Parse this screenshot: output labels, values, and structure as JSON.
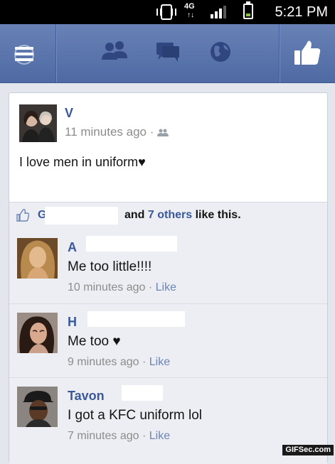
{
  "status_bar": {
    "time": "5:21 PM",
    "network": "4G",
    "network_arrows": "↑↓",
    "icons": [
      "vibrate-icon",
      "signal-icon",
      "battery-icon"
    ]
  },
  "nav": {
    "icons": [
      "menu-icon",
      "friend-requests-icon",
      "messages-icon",
      "notifications-globe-icon",
      "like-thumb-icon"
    ]
  },
  "post": {
    "author": "V",
    "time": "11 minutes ago",
    "separator": "·",
    "audience_icon": "friends-icon",
    "text": "I love men in uniform♥"
  },
  "likes": {
    "first_name": "G",
    "and": "and",
    "others": "7 others",
    "suffix": "like this."
  },
  "comments": [
    {
      "name": "A",
      "text": "Me too little!!!!",
      "time": "10 minutes ago",
      "separator": "·",
      "like": "Like"
    },
    {
      "name": "H",
      "text": "Me too ♥",
      "time": "9 minutes ago",
      "separator": "·",
      "like": "Like"
    },
    {
      "name": "Tavon",
      "text": "I got a KFC uniform lol",
      "time": "7 minutes ago",
      "separator": "·",
      "like": "Like"
    }
  ],
  "watermark": "GIFSec.com",
  "colors": {
    "facebook_blue": "#3b5998",
    "header_gradient_top": "#6882b6",
    "header_gradient_bottom": "#4f6aa3",
    "background": "#e3e6ec"
  }
}
